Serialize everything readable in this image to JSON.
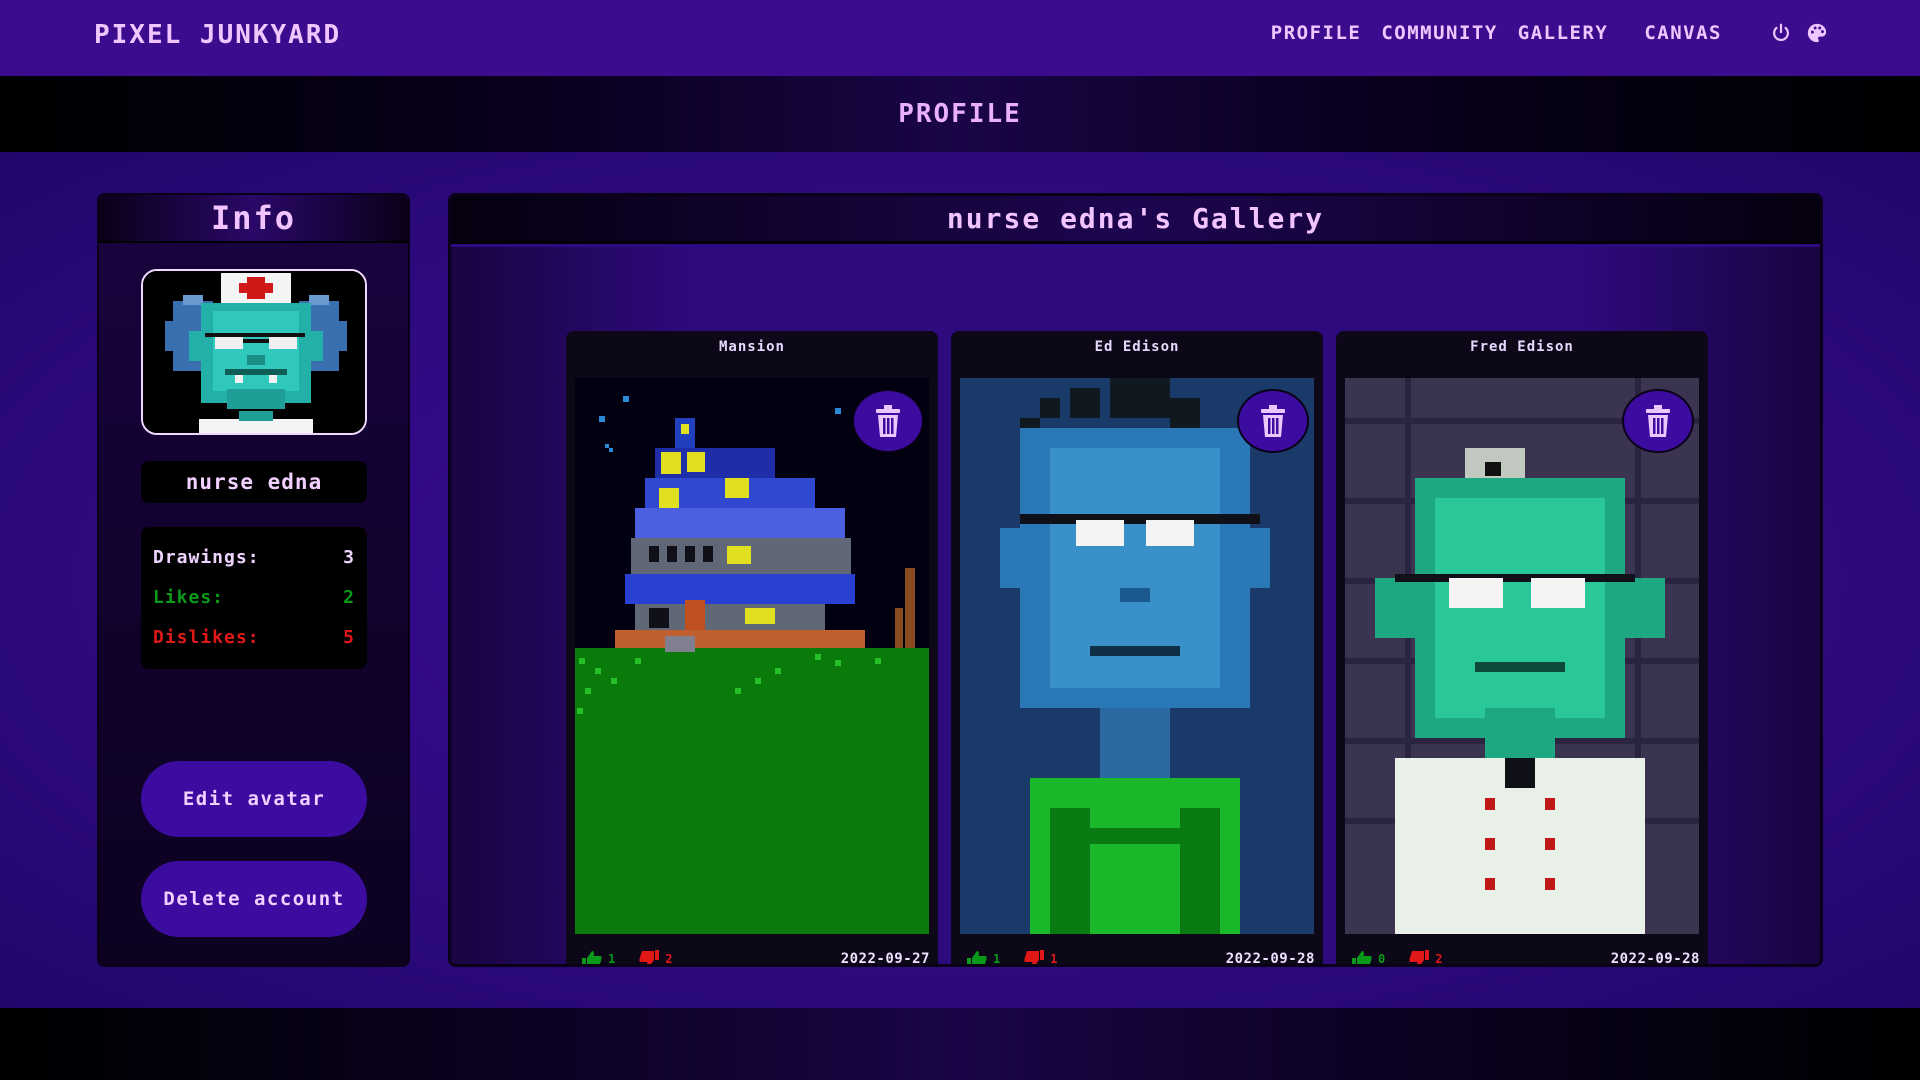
{
  "brand": "PIXEL JUNKYARD",
  "nav": {
    "links": [
      "PROFILE",
      "COMMUNITY",
      "GALLERY",
      "CANVAS"
    ],
    "icons": [
      "power-icon",
      "palette-icon"
    ]
  },
  "page_title": "PROFILE",
  "info": {
    "title": "Info",
    "username": "nurse edna",
    "stats": [
      {
        "label": "Drawings:",
        "value": "3"
      },
      {
        "label": "Likes:",
        "value": "2"
      },
      {
        "label": "Dislikes:",
        "value": "5"
      }
    ],
    "edit_avatar_label": "Edit avatar",
    "delete_account_label": "Delete account"
  },
  "gallery": {
    "title": "nurse edna's Gallery",
    "cards": [
      {
        "title": "Mansion",
        "likes": "1",
        "dislikes": "2",
        "date": "2022-09-27"
      },
      {
        "title": "Ed Edison",
        "likes": "1",
        "dislikes": "1",
        "date": "2022-09-28"
      },
      {
        "title": "Fred Edison",
        "likes": "0",
        "dislikes": "2",
        "date": "2022-09-28"
      }
    ]
  },
  "colors": {
    "accent": "#3c0ca0",
    "likes": "#0a9a1a",
    "dislikes": "#e01818",
    "text": "#f0c6ff"
  }
}
